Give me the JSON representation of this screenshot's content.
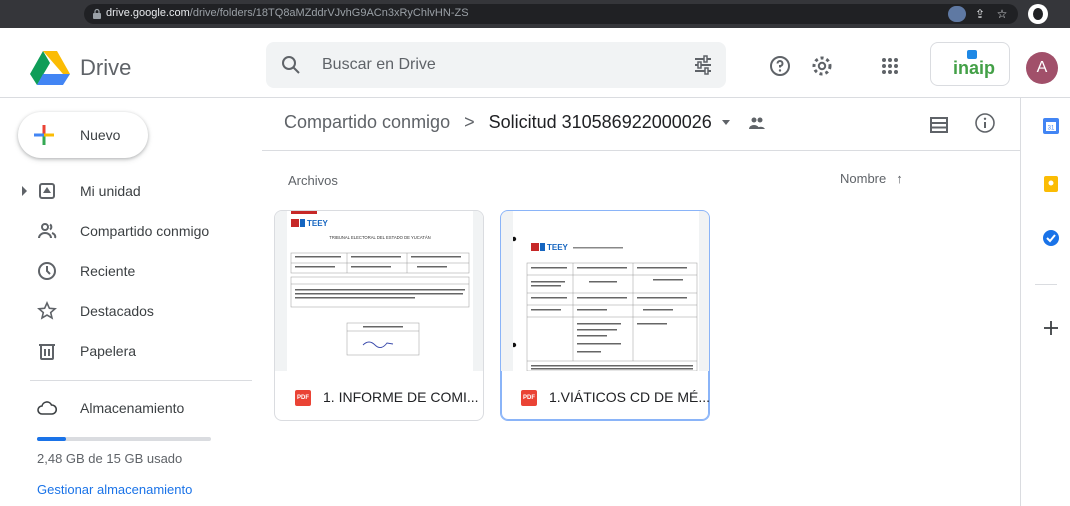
{
  "browser": {
    "url_host": "drive.google.com",
    "url_path": "/drive/folders/18TQ8aMZddrVJvhG9ACn3xRyChlvHN-ZS"
  },
  "header": {
    "brand": "Drive",
    "search_placeholder": "Buscar en Drive",
    "org_badge": "inaip",
    "avatar_letter": "A"
  },
  "sidebar": {
    "new_label": "Nuevo",
    "items": [
      {
        "label": "Mi unidad",
        "icon": "my-drive-icon"
      },
      {
        "label": "Compartido conmigo",
        "icon": "shared-icon"
      },
      {
        "label": "Reciente",
        "icon": "clock-icon"
      },
      {
        "label": "Destacados",
        "icon": "star-icon"
      },
      {
        "label": "Papelera",
        "icon": "trash-icon"
      }
    ],
    "storage_label": "Almacenamiento",
    "storage_fraction": 0.166,
    "storage_text": "2,48 GB de 15 GB usado",
    "storage_link": "Gestionar almacenamiento"
  },
  "main": {
    "breadcrumb_parent": "Compartido conmigo",
    "breadcrumb_sep": ">",
    "breadcrumb_current": "Solicitud 310586922000026",
    "section_title": "Archivos",
    "sort_label": "Nombre",
    "files": [
      {
        "name": "1. INFORME DE COMI...",
        "type": "PDF",
        "thumb_logo": "TEEY"
      },
      {
        "name": "1.VIÁTICOS CD DE MÉ...",
        "type": "PDF",
        "thumb_logo": "TEEY"
      }
    ],
    "file1_thumb_title": "TRIBUNAL ELECTORAL DEL ESTADO DE YUCATÁN"
  },
  "colors": {
    "accent": "#1a73e8",
    "pdf_red": "#ea4335",
    "text": "#202124",
    "secondary": "#5f6368",
    "border": "#dadce0"
  }
}
